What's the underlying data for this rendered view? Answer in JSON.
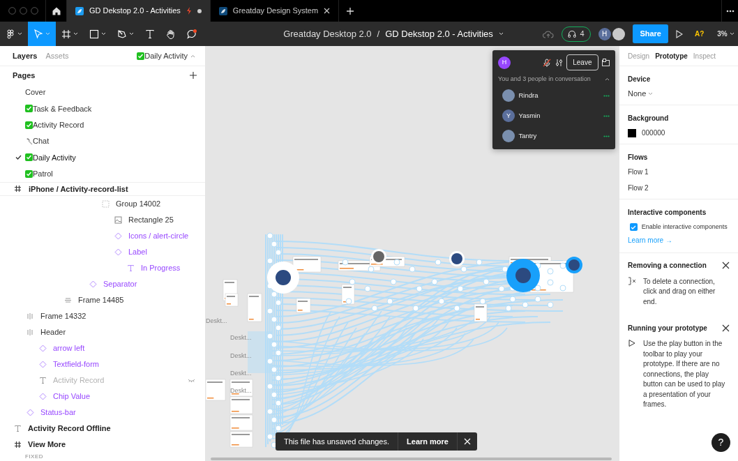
{
  "tab_bar": {
    "tabs": [
      {
        "label": "GD Dekstop 2.0 - Activities",
        "selected": true,
        "unsaved": true
      },
      {
        "label": "Greatday Design System",
        "selected": false,
        "unsaved": false
      }
    ]
  },
  "toolbar": {
    "tools": [
      {
        "kind": "main-menu",
        "selected": false,
        "notification": false
      },
      {
        "kind": "move",
        "selected": true,
        "notification": false
      },
      {
        "kind": "frame",
        "selected": false,
        "notification": false
      },
      {
        "kind": "shape",
        "selected": false,
        "notification": false
      },
      {
        "kind": "pen",
        "selected": false,
        "notification": false
      },
      {
        "kind": "text",
        "selected": false,
        "notification": false
      },
      {
        "kind": "hand",
        "selected": false,
        "notification": false
      },
      {
        "kind": "comment",
        "selected": false,
        "notification": true
      }
    ],
    "breadcrumb": {
      "project": "Greatday Desktop 2.0",
      "separator": "/",
      "file": "GD Dekstop 2.0 - Activities"
    },
    "audio": {
      "count": "4"
    },
    "avatars": [
      {
        "kind": "initial",
        "initial": "H",
        "color": "#5b6f9c"
      },
      {
        "kind": "photo"
      }
    ],
    "share": "Share",
    "font_warning": "A?",
    "zoom": "3%"
  },
  "left_panel": {
    "tabs": [
      {
        "label": "Layers",
        "selected": true
      },
      {
        "label": "Assets",
        "selected": false
      }
    ],
    "page_selector": {
      "kind": "check",
      "label": "Daily Activity"
    },
    "pages_title": "Pages",
    "pages": [
      {
        "label": "Cover",
        "kind": "plain",
        "selected": false
      },
      {
        "label": "Task & Feedback",
        "kind": "check",
        "selected": false
      },
      {
        "label": "Activity Record",
        "kind": "check",
        "selected": false
      },
      {
        "label": "Chat",
        "kind": "hammer",
        "selected": false
      },
      {
        "label": "Daily Activity",
        "kind": "check",
        "selected": true
      },
      {
        "label": "Patrol",
        "kind": "check",
        "selected": false
      }
    ],
    "layers": {
      "label": "iPhone / Activity-record-list",
      "kind": "frame",
      "visible": true,
      "children": [
        {
          "children": [
            {
              "children": [
                {
                  "children": [
                    {
                      "children": [
                        {
                          "children": [
                            {
                              "children": [
                                {
                                  "label": "Group 14002",
                                  "kind": "group",
                                  "visible": true,
                                  "children": [
                                    {
                                      "label": "Rectangle 25",
                                      "kind": "image",
                                      "visible": true
                                    },
                                    {
                                      "label": "Icons / alert-circle",
                                      "kind": "instance",
                                      "visible": true
                                    },
                                    {
                                      "label": "Label",
                                      "kind": "instance",
                                      "visible": true,
                                      "children": [
                                        {
                                          "label": "In Progress",
                                          "kind": "text-instance",
                                          "visible": true
                                        }
                                      ]
                                    }
                                  ]
                                }
                              ]
                            },
                            {
                              "label": "Separator",
                              "kind": "instance",
                              "visible": true
                            }
                          ]
                        }
                      ]
                    },
                    {
                      "label": "Frame 14485",
                      "kind": "stack-vertical",
                      "visible": true
                    }
                  ]
                }
              ]
            }
          ]
        },
        {
          "label": "Frame 14332",
          "kind": "stack-horizontal",
          "visible": true
        },
        {
          "label": "Header",
          "kind": "stack-horizontal",
          "visible": true,
          "children": [
            {
              "label": "arrow left",
              "kind": "instance",
              "visible": true
            },
            {
              "label": "Textfield-form",
              "kind": "instance",
              "visible": true
            },
            {
              "label": "Activity Record",
              "kind": "text",
              "visible": false
            },
            {
              "label": "Chip Value",
              "kind": "instance",
              "visible": true
            }
          ]
        },
        {
          "label": "Status-bar",
          "kind": "instance",
          "visible": true
        }
      ]
    },
    "more_layers": [
      {
        "label": "Activity Record Offline",
        "kind": "text",
        "visible": true
      },
      {
        "label": "View More",
        "kind": "frame",
        "visible": true,
        "section": "FIXED"
      }
    ]
  },
  "canvas": {
    "frame_labels": [
      "Deskt...",
      "Deskt...",
      "Deskt...",
      "Deskt...",
      "Deskt..."
    ],
    "call": {
      "me": {
        "initial": "H",
        "color": "#9747ff"
      },
      "muted": true,
      "leave": "Leave",
      "summary": "You and 3 people in conversation",
      "participants": [
        {
          "name": "Rindra",
          "kind": "photo"
        },
        {
          "name": "Yasmin",
          "kind": "initial",
          "initial": "Y",
          "color": "#5b6f9c"
        },
        {
          "name": "Tantry",
          "kind": "photo"
        }
      ]
    },
    "toast": {
      "message": "This file has unsaved changes.",
      "action": "Learn more"
    }
  },
  "right_panel": {
    "tabs": [
      {
        "label": "Design",
        "selected": false
      },
      {
        "label": "Prototype",
        "selected": true
      },
      {
        "label": "Inspect",
        "selected": false
      }
    ],
    "device": {
      "title": "Device",
      "value": "None"
    },
    "background": {
      "title": "Background",
      "value": "000000"
    },
    "flows": {
      "title": "Flows",
      "items": [
        "Flow 1",
        "Flow 2"
      ]
    },
    "interactive": {
      "title": "Interactive components",
      "checkbox": "Enable interactive components",
      "checked": true,
      "link": "Learn more →"
    },
    "tips": [
      {
        "kind": "connection",
        "title": "Removing a connection",
        "text": "To delete a connection, click and drag on either end."
      },
      {
        "kind": "play",
        "title": "Running your prototype",
        "text": "Use the play button in the toolbar to play your prototype. If there are no connections, the play button can be used to play a presentation of your frames."
      }
    ]
  },
  "help": "?"
}
